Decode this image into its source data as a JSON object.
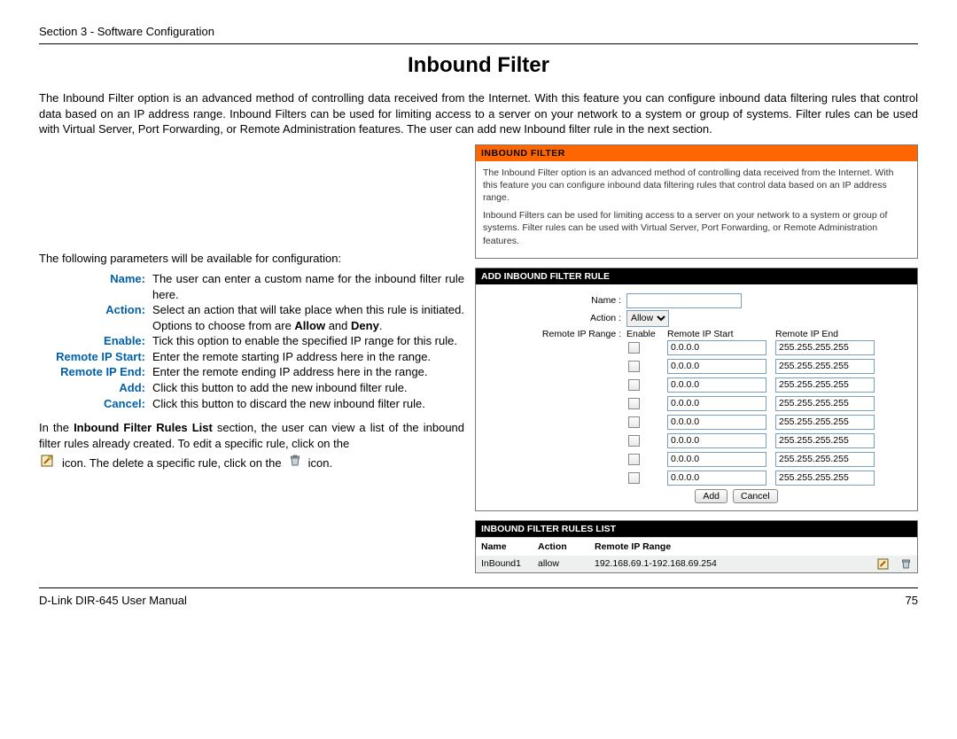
{
  "header": {
    "section": "Section 3 - Software Configuration"
  },
  "title": "Inbound Filter",
  "intro": "The Inbound Filter option is an advanced method of controlling data received from the Internet. With this feature you can configure inbound data filtering rules that control data based on an IP address range. Inbound Filters can be used for limiting access to a server on your network to a system or group of systems. Filter rules can be used with Virtual Server, Port Forwarding, or Remote Administration features. The user can add new Inbound filter rule in the next section.",
  "params_intro": "The following parameters will be available for configuration:",
  "params": {
    "name": {
      "label": "Name:",
      "desc": "The user can enter a custom name for the inbound filter rule here."
    },
    "action": {
      "label": "Action:",
      "desc_pre": "Select an action that will take place when this rule is initiated. Options to choose from are ",
      "opt1": "Allow",
      "mid": " and ",
      "opt2": "Deny",
      "post": "."
    },
    "enable": {
      "label": "Enable:",
      "desc": "Tick this option to enable the specified IP range for this rule."
    },
    "start": {
      "label": "Remote IP Start:",
      "desc": "Enter the remote starting IP address here in the range."
    },
    "end": {
      "label": "Remote IP End:",
      "desc": "Enter the remote ending IP address here in the range."
    },
    "add": {
      "label": "Add:",
      "desc": "Click this button to add the new inbound filter rule."
    },
    "cancel": {
      "label": "Cancel:",
      "desc": "Click this button to discard the new inbound filter rule."
    }
  },
  "rules_intro_pre": "In the ",
  "rules_intro_bold": "Inbound Filter Rules List",
  "rules_intro_post": " section, the user can view a list of the inbound filter rules already created. To edit a specific rule, click on the",
  "rules_intro_line2a": "icon. The delete a specific rule, click on the",
  "rules_intro_line2b": "icon.",
  "panel1": {
    "header": "INBOUND FILTER",
    "p1": "The Inbound Filter option is an advanced method of controlling data received from the Internet. With this feature you can configure inbound data filtering rules that control data based on an IP address range.",
    "p2": "Inbound Filters can be used for limiting access to a server on your network to a system or group of systems. Filter rules can be used with Virtual Server, Port Forwarding, or Remote Administration features."
  },
  "panel2": {
    "header": "ADD INBOUND FILTER RULE",
    "name_label": "Name :",
    "action_label": "Action :",
    "action_value": "Allow",
    "range_label": "Remote IP Range :",
    "cols": {
      "enable": "Enable",
      "start": "Remote IP Start",
      "end": "Remote IP End"
    },
    "rows": [
      {
        "start": "0.0.0.0",
        "end": "255.255.255.255"
      },
      {
        "start": "0.0.0.0",
        "end": "255.255.255.255"
      },
      {
        "start": "0.0.0.0",
        "end": "255.255.255.255"
      },
      {
        "start": "0.0.0.0",
        "end": "255.255.255.255"
      },
      {
        "start": "0.0.0.0",
        "end": "255.255.255.255"
      },
      {
        "start": "0.0.0.0",
        "end": "255.255.255.255"
      },
      {
        "start": "0.0.0.0",
        "end": "255.255.255.255"
      },
      {
        "start": "0.0.0.0",
        "end": "255.255.255.255"
      }
    ],
    "add_btn": "Add",
    "cancel_btn": "Cancel"
  },
  "panel3": {
    "header": "INBOUND FILTER RULES LIST",
    "cols": {
      "name": "Name",
      "action": "Action",
      "range": "Remote IP Range"
    },
    "rows": [
      {
        "name": "InBound1",
        "action": "allow",
        "range": "192.168.69.1-192.168.69.254"
      }
    ]
  },
  "footer": {
    "left": "D-Link DIR-645 User Manual",
    "right": "75"
  }
}
